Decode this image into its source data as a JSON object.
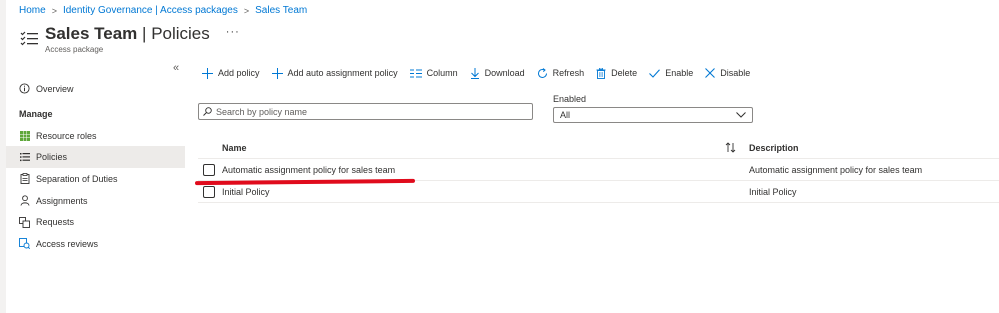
{
  "breadcrumb": [
    "Home",
    "Identity Governance | Access packages",
    "Sales Team"
  ],
  "header": {
    "title_main": "Sales Team",
    "title_sep": "|",
    "title_section": "Policies",
    "subtitle": "Access package",
    "more": "···"
  },
  "sidebar": {
    "collapse": "«",
    "overview": "Overview",
    "heading": "Manage",
    "items": [
      {
        "label": "Resource roles",
        "icon": "grid-icon"
      },
      {
        "label": "Policies",
        "icon": "list-icon",
        "selected": true
      },
      {
        "label": "Separation of Duties",
        "icon": "clipboard-icon"
      },
      {
        "label": "Assignments",
        "icon": "person-icon"
      },
      {
        "label": "Requests",
        "icon": "requests-icon"
      },
      {
        "label": "Access reviews",
        "icon": "review-icon"
      }
    ]
  },
  "toolbar": {
    "add_policy": "Add policy",
    "add_auto": "Add auto assignment policy",
    "column": "Column",
    "download": "Download",
    "refresh": "Refresh",
    "delete": "Delete",
    "enable": "Enable",
    "disable": "Disable"
  },
  "search": {
    "placeholder": "Search by policy name"
  },
  "filter": {
    "label": "Enabled",
    "value": "All"
  },
  "table": {
    "col_name": "Name",
    "col_desc": "Description",
    "rows": [
      {
        "name": "Automatic assignment policy for sales team",
        "description": "Automatic assignment policy for sales team"
      },
      {
        "name": "Initial Policy",
        "description": "Initial Policy"
      }
    ]
  },
  "colors": {
    "accent": "#0078d4",
    "annotation": "#e00b1c"
  }
}
